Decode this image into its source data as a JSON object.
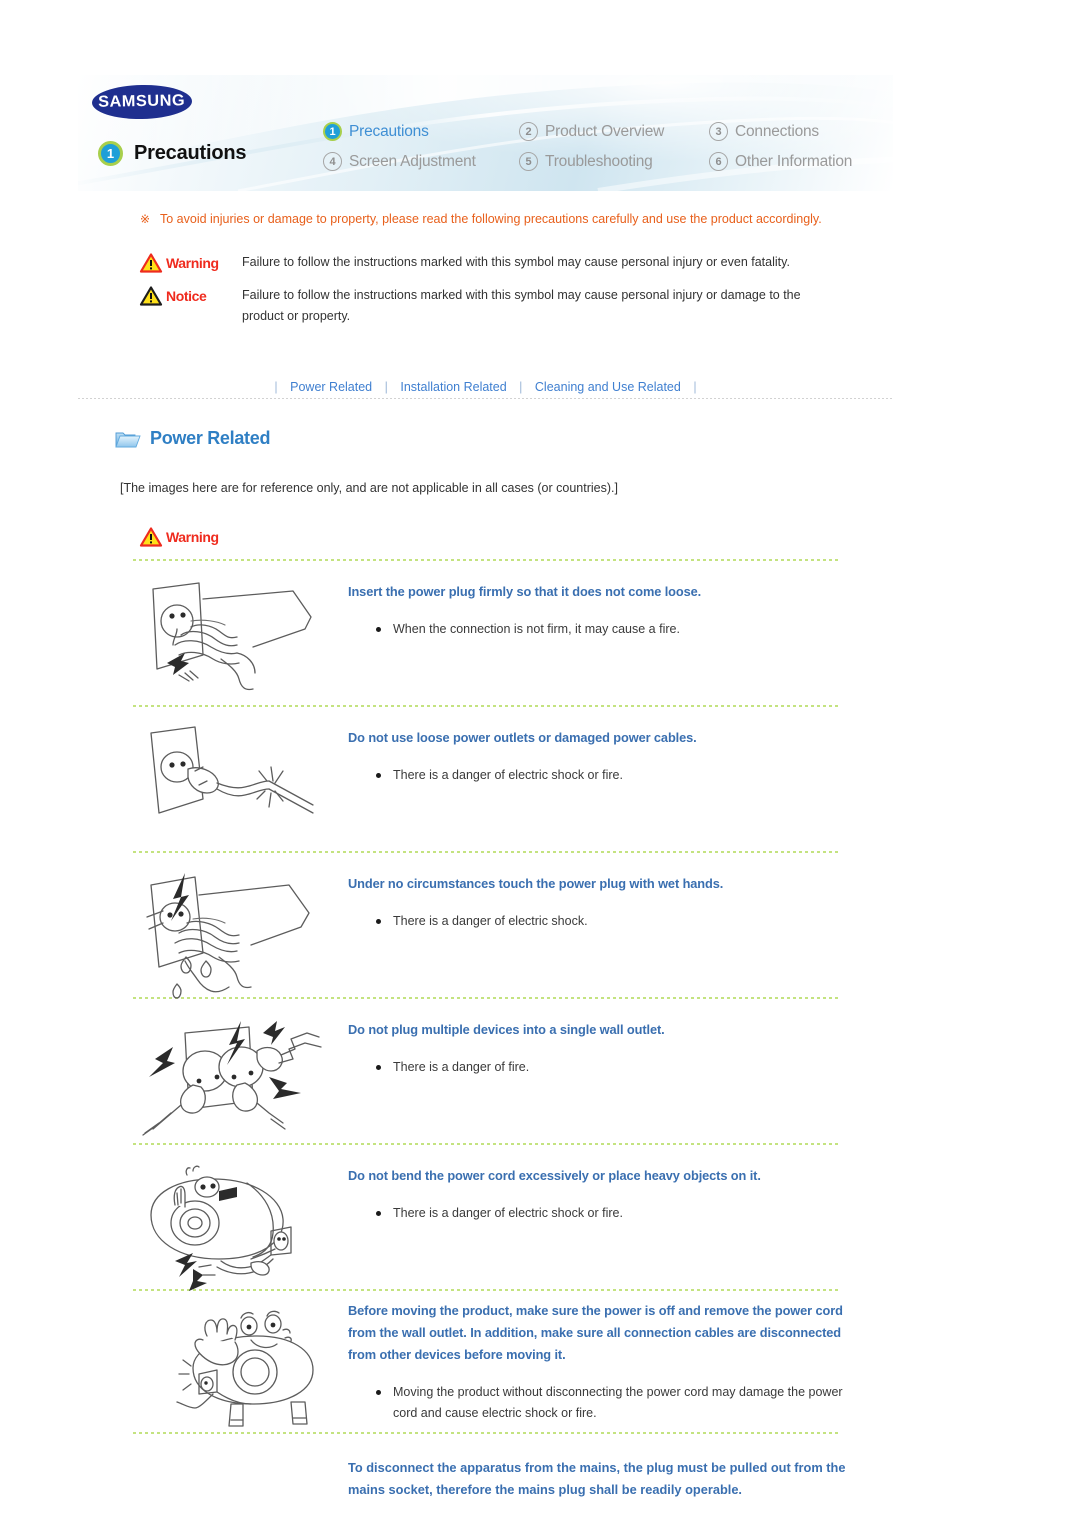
{
  "header": {
    "brand": "SAMSUNG",
    "page_number": "1",
    "page_title": "Precautions",
    "nav_items": [
      {
        "num": "1",
        "label": "Precautions",
        "active": true
      },
      {
        "num": "2",
        "label": "Product Overview",
        "active": false
      },
      {
        "num": "3",
        "label": "Connections",
        "active": false
      },
      {
        "num": "4",
        "label": "Screen Adjustment",
        "active": false
      },
      {
        "num": "5",
        "label": "Troubleshooting",
        "active": false
      },
      {
        "num": "6",
        "label": "Other Information",
        "active": false
      }
    ]
  },
  "intro": {
    "marker": "※",
    "text": "To avoid injuries or damage to property, please read the following precautions carefully and use the product accordingly."
  },
  "legend": {
    "warning": {
      "label": "Warning",
      "text": "Failure to follow the instructions marked with this symbol may cause personal injury or even fatality."
    },
    "notice": {
      "label": "Notice",
      "text": "Failure to follow the instructions marked with this symbol may cause personal injury or damage to the product or property."
    }
  },
  "subnav": {
    "items": [
      "Power Related",
      "Installation Related",
      "Cleaning and Use Related"
    ],
    "separator": "|"
  },
  "section": {
    "title": "Power Related",
    "reference_note": "[The images here are for reference only, and are not applicable in all cases (or countries).]",
    "warning_label": "Warning"
  },
  "precautions": [
    {
      "icon": "hand-inserting-plug-into-outlet",
      "title": "Insert the power plug firmly so that it does not come loose.",
      "bullets": [
        "When the connection is not firm, it may cause a fire."
      ]
    },
    {
      "icon": "damaged-power-cable-in-outlet",
      "title": "Do not use loose power outlets or damaged power cables.",
      "bullets": [
        "There is a danger of electric shock or fire."
      ]
    },
    {
      "icon": "wet-hand-touching-plug",
      "title": "Under no circumstances touch the power plug with wet hands.",
      "bullets": [
        "There is a danger of electric shock."
      ]
    },
    {
      "icon": "multiple-plugs-single-outlet",
      "title": "Do not plug multiple devices into a single wall outlet.",
      "bullets": [
        "There is a danger of fire."
      ]
    },
    {
      "icon": "heavy-object-on-power-cord",
      "title": "Do not bend the power cord excessively or place heavy objects on it.",
      "bullets": [
        "There is a danger of electric shock or fire."
      ]
    },
    {
      "icon": "unplug-before-moving-product",
      "title": "Before moving the product, make sure the power is off and remove the power cord from the wall outlet. In addition, make sure all connection cables are disconnected from other devices before moving it.",
      "bullets": [
        "Moving the product without disconnecting the power cord may damage the power cord and cause electric shock or fire."
      ]
    }
  ],
  "tail_note": "To disconnect the apparatus from the mains, the plug must be pulled out from the mains socket, therefore the mains plug shall be readily operable.",
  "colors": {
    "accent_blue": "#3a6fb0",
    "link_blue": "#3f7fd0",
    "warning_red": "#ef2b1e",
    "intro_orange": "#e8601c",
    "divider_green": "#b9de6a",
    "brand_navy": "#1f2f8f",
    "badge_blue": "#1f9fd8",
    "badge_ring_green": "#a8cf4c"
  }
}
